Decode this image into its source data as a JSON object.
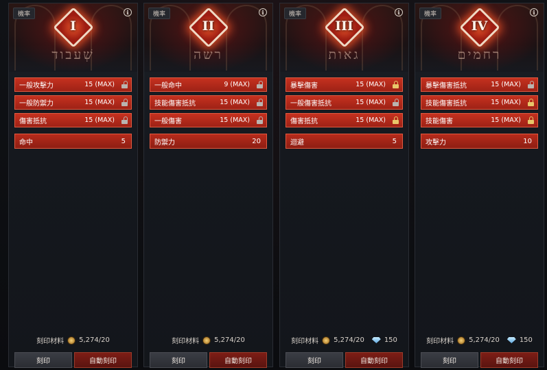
{
  "tag_label": "機率",
  "info_symbol": "i",
  "footer_label": "刻印材料",
  "button_engrave": "刻印",
  "button_auto": "自動刻印",
  "accent_color": "#c5311f",
  "panels": [
    {
      "numeral": "I",
      "glyph": "שְׁעבוד",
      "stats": [
        {
          "name": "一般攻擊力",
          "value": "15 (MAX)",
          "lock": "grey"
        },
        {
          "name": "一般防禦力",
          "value": "15 (MAX)",
          "lock": "grey"
        },
        {
          "name": "傷害抵抗",
          "value": "15 (MAX)",
          "lock": "grey"
        }
      ],
      "bonus": {
        "name": "命中",
        "value": "5"
      },
      "coin_amount": "5,274/20",
      "gem_amount": ""
    },
    {
      "numeral": "II",
      "glyph": "רשה",
      "stats": [
        {
          "name": "一般命中",
          "value": "9 (MAX)",
          "lock": "grey"
        },
        {
          "name": "技能傷害抵抗",
          "value": "15 (MAX)",
          "lock": "grey"
        },
        {
          "name": "一般傷害",
          "value": "15 (MAX)",
          "lock": "grey"
        }
      ],
      "bonus": {
        "name": "防禦力",
        "value": "20"
      },
      "coin_amount": "5,274/20",
      "gem_amount": ""
    },
    {
      "numeral": "III",
      "glyph": "גאות",
      "stats": [
        {
          "name": "暴擊傷害",
          "value": "15 (MAX)",
          "lock": "gold"
        },
        {
          "name": "一般傷害抵抗",
          "value": "15 (MAX)",
          "lock": "grey"
        },
        {
          "name": "傷害抵抗",
          "value": "15 (MAX)",
          "lock": "gold"
        }
      ],
      "bonus": {
        "name": "迴避",
        "value": "5"
      },
      "coin_amount": "5,274/20",
      "gem_amount": "150"
    },
    {
      "numeral": "IV",
      "glyph": "רחמים",
      "stats": [
        {
          "name": "暴擊傷害抵抗",
          "value": "15 (MAX)",
          "lock": "grey"
        },
        {
          "name": "技能傷害抵抗",
          "value": "15 (MAX)",
          "lock": "gold"
        },
        {
          "name": "技能傷害",
          "value": "15 (MAX)",
          "lock": "gold"
        }
      ],
      "bonus": {
        "name": "攻擊力",
        "value": "10"
      },
      "coin_amount": "5,274/20",
      "gem_amount": "150"
    }
  ]
}
